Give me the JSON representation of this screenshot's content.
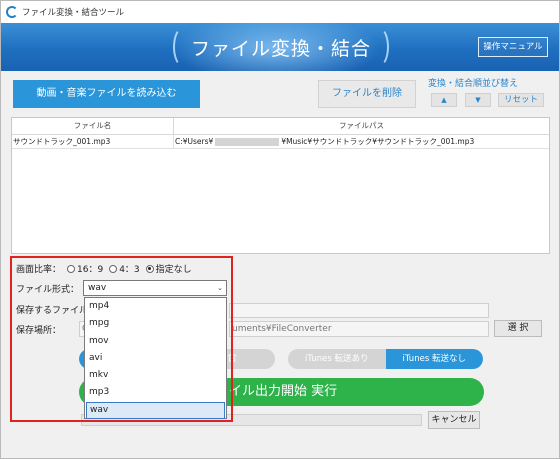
{
  "window": {
    "title": "ファイル変換・結合ツール"
  },
  "banner": {
    "title": "ファイル変換・結合",
    "manual_label": "操作マニュアル"
  },
  "toolbar": {
    "load_label": "動画・音楽ファイルを読み込む",
    "delete_label": "ファイルを削除",
    "order_label": "変換・結合順並び替え",
    "up_label": "▲",
    "down_label": "▼",
    "reset_label": "リセット"
  },
  "table": {
    "columns": [
      "ファイル名",
      "ファイルパス"
    ],
    "rows": [
      {
        "name": "サウンドトラック_001.mp3",
        "path_start": "C:¥Users¥",
        "path_end": "¥Music¥サウンドトラック¥サウンドトラック_001.mp3"
      }
    ]
  },
  "options": {
    "ratio_label": "画面比率：",
    "ratio_options": [
      "16：9",
      "4：3",
      "指定なし"
    ],
    "ratio_selected": "指定なし",
    "format_label": "ファイル形式：",
    "format_value": "wav",
    "format_options": [
      "mp4",
      "mpg",
      "mov",
      "avi",
      "mkv",
      "mp3",
      "wav"
    ],
    "save_file_label": "保存するファイル",
    "save_location_label": "保存場所：",
    "save_location_prefix": "C",
    "save_location_value": "uments¥FileConverter",
    "browse_label": "選 択"
  },
  "mode": {
    "combine_label": "合",
    "itunes_yes": "iTunes 転送あり",
    "itunes_no": "iTunes 転送なし"
  },
  "execute": {
    "label": "イル出力開始 実行",
    "cancel_label": "キャンセル"
  },
  "colors": {
    "accent": "#2a95d9",
    "execute": "#2db34a",
    "highlight": "#e0231f"
  }
}
